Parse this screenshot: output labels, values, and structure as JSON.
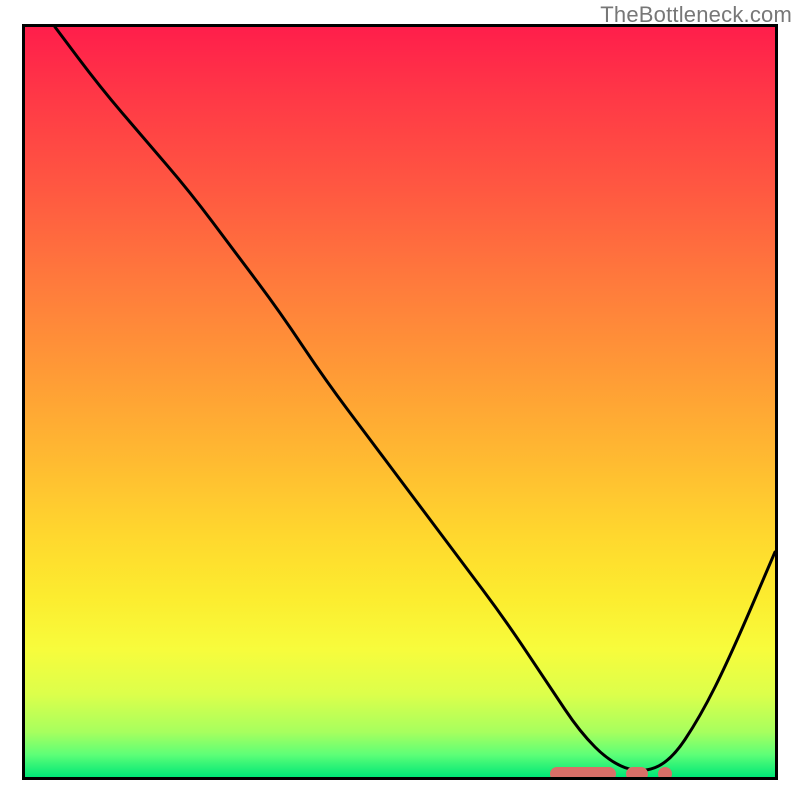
{
  "watermark": "TheBottleneck.com",
  "colors": {
    "gradient_top": "#ff1e4b",
    "gradient_bottom": "#00e777",
    "marker": "#d96f68",
    "curve": "#000000"
  },
  "chart_data": {
    "type": "line",
    "title": "",
    "xlabel": "",
    "ylabel": "",
    "xlim": [
      0,
      100
    ],
    "ylim": [
      0,
      100
    ],
    "grid": false,
    "series": [
      {
        "name": "curve",
        "x": [
          4,
          10,
          16,
          22,
          28,
          34,
          40,
          46,
          52,
          58,
          64,
          70,
          74,
          78,
          82,
          86,
          90,
          94,
          100
        ],
        "values": [
          100,
          92,
          85,
          78,
          70,
          62,
          53,
          45,
          37,
          29,
          21,
          12,
          6,
          2,
          0.5,
          2,
          8,
          16,
          30
        ]
      }
    ],
    "valley_markers": {
      "x_range": [
        70,
        86
      ],
      "y": 0.5
    }
  }
}
